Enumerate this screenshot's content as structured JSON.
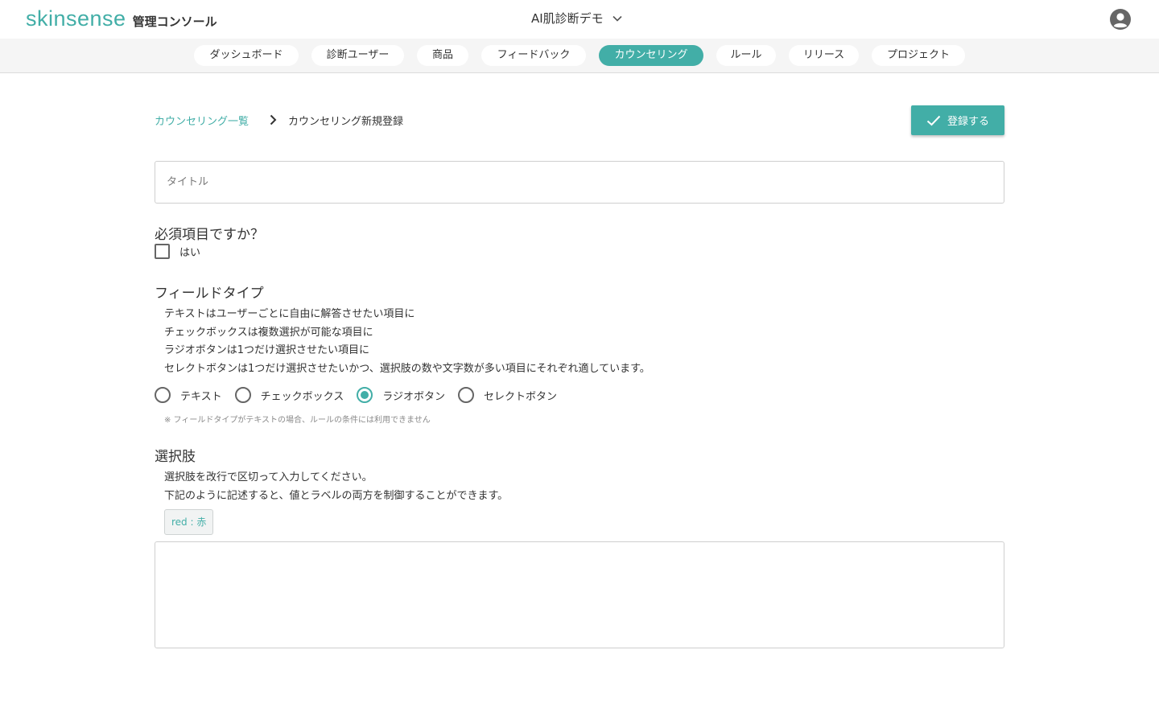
{
  "header": {
    "logo": "skinsense",
    "subtitle": "管理コンソール",
    "project": "AI肌診断デモ",
    "icons": {
      "project_dropdown": "chevron-down-icon",
      "account": "user-circle-icon"
    }
  },
  "nav": {
    "items": [
      {
        "label": "ダッシュボード",
        "active": false
      },
      {
        "label": "診断ユーザー",
        "active": false
      },
      {
        "label": "商品",
        "active": false
      },
      {
        "label": "フィードバック",
        "active": false
      },
      {
        "label": "カウンセリング",
        "active": true
      },
      {
        "label": "ルール",
        "active": false
      },
      {
        "label": "リリース",
        "active": false
      },
      {
        "label": "プロジェクト",
        "active": false
      }
    ]
  },
  "breadcrumb": {
    "parent": "カウンセリング一覧",
    "current": "カウンセリング新規登録",
    "separator_icon": "chevron-right-icon"
  },
  "actions": {
    "submit_label": "登録する",
    "submit_icon": "check-icon"
  },
  "form": {
    "title_placeholder": "タイトル",
    "title_value": "",
    "required": {
      "heading": "必須項目ですか？",
      "checkbox_label": "はい",
      "checked": false
    },
    "field_type": {
      "heading": "フィールドタイプ",
      "description": [
        "テキストはユーザーごとに自由に解答させたい項目に",
        "チェックボックスは複数選択が可能な項目に",
        "ラジオボタンは1つだけ選択させたい項目に",
        "セレクトボタンは1つだけ選択させたいかつ、選択肢の数や文字数が多い項目にそれぞれ適しています。"
      ],
      "options": [
        {
          "label": "テキスト",
          "selected": false
        },
        {
          "label": "チェックボックス",
          "selected": false
        },
        {
          "label": "ラジオボタン",
          "selected": true
        },
        {
          "label": "セレクトボタン",
          "selected": false
        }
      ],
      "note": "※ フィールドタイプがテキストの場合、ルールの条件には利用できません"
    },
    "choices": {
      "heading": "選択肢",
      "description": [
        "選択肢を改行で区切って入力してください。",
        "下記のように記述すると、値とラベルの両方を制御することができます。"
      ],
      "example": "red : 赤",
      "value": ""
    }
  },
  "colors": {
    "accent": "#42aea7",
    "nav_bg": "#f5f5f5",
    "border": "#cfcfcf"
  }
}
